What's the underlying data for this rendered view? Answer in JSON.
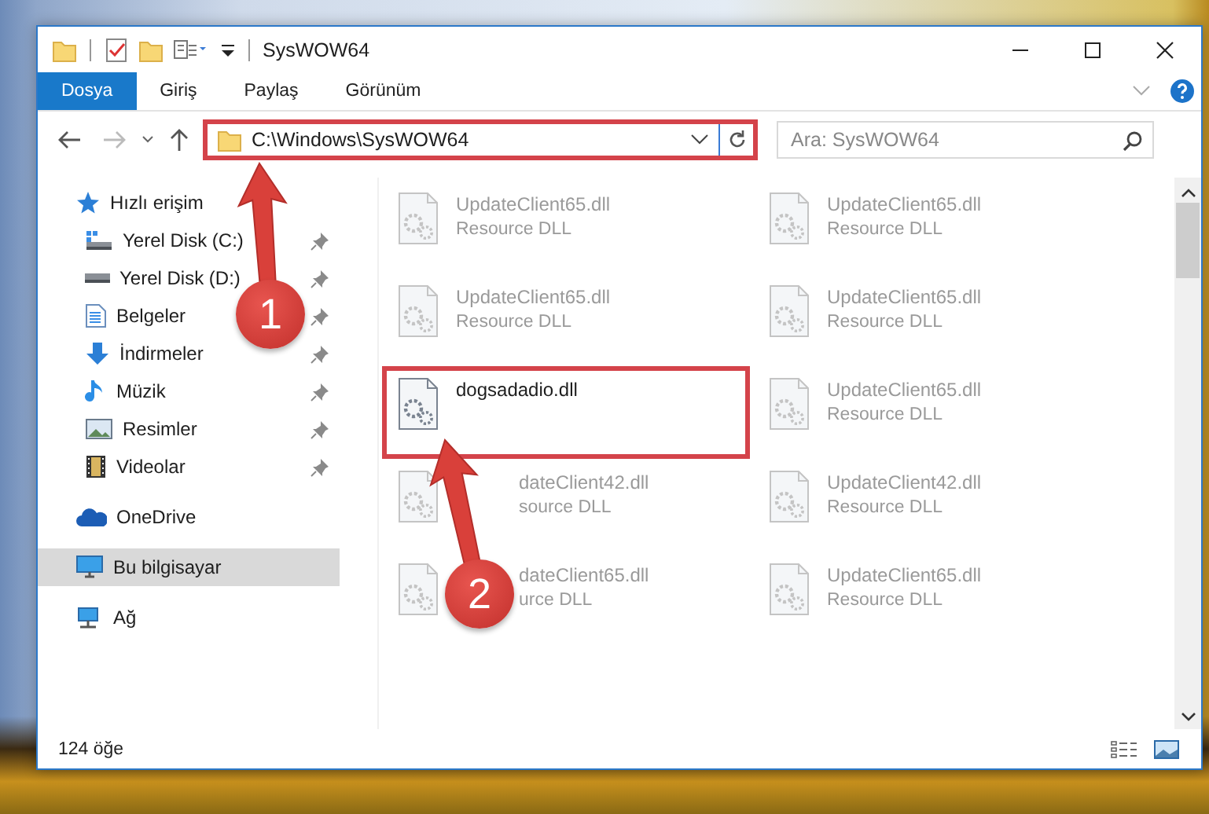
{
  "window": {
    "title": "SysWOW64"
  },
  "ribbon_tabs": [
    {
      "label": "Dosya",
      "selected": true
    },
    {
      "label": "Giriş",
      "selected": false
    },
    {
      "label": "Paylaş",
      "selected": false
    },
    {
      "label": "Görünüm",
      "selected": false
    }
  ],
  "address_bar": {
    "value": "C:\\Windows\\SysWOW64",
    "highlighted": true
  },
  "search": {
    "placeholder": "Ara: SysWOW64"
  },
  "navigation": [
    {
      "label": "Hızlı erişim",
      "kind": "quick",
      "selected": false,
      "children": [
        {
          "label": "Yerel Disk (C:)",
          "kind": "disk-c",
          "selected": false,
          "pinned": true
        },
        {
          "label": "Yerel Disk (D:)",
          "kind": "disk",
          "selected": false,
          "pinned": true
        },
        {
          "label": "Belgeler",
          "kind": "documents",
          "selected": false,
          "pinned": true
        },
        {
          "label": "İndirmeler",
          "kind": "downloads",
          "selected": false,
          "pinned": true
        },
        {
          "label": "Müzik",
          "kind": "music",
          "selected": false,
          "pinned": true
        },
        {
          "label": "Resimler",
          "kind": "pictures",
          "selected": false,
          "pinned": true
        },
        {
          "label": "Videolar",
          "kind": "videos",
          "selected": false,
          "pinned": true
        }
      ]
    },
    {
      "label": "OneDrive",
      "kind": "cloud",
      "selected": false
    },
    {
      "label": "Bu bilgisayar",
      "kind": "pc",
      "selected": true
    },
    {
      "label": "Ağ",
      "kind": "network",
      "selected": false
    }
  ],
  "files": [
    {
      "name": "UpdateClient65.dll",
      "type": "Resource DLL",
      "kind": "faded"
    },
    {
      "name": "UpdateClient65.dll",
      "type": "Resource DLL",
      "kind": "faded"
    },
    {
      "name": "UpdateClient65.dll",
      "type": "Resource DLL",
      "kind": "faded"
    },
    {
      "name": "UpdateClient65.dll",
      "type": "Resource DLL",
      "kind": "faded"
    },
    {
      "name": "dogsadadio.dll",
      "kind": "normal",
      "highlighted": true
    },
    {
      "name": "UpdateClient65.dll",
      "type": "Resource DLL",
      "kind": "faded"
    },
    {
      "name": "dateClient42.dll",
      "type": "source DLL",
      "kind": "covered"
    },
    {
      "name": "UpdateClient42.dll",
      "type": "Resource DLL",
      "kind": "faded"
    },
    {
      "name": "dateClient65.dll",
      "type": "urce DLL",
      "kind": "covered"
    },
    {
      "name": "UpdateClient65.dll",
      "type": "Resource DLL",
      "kind": "faded"
    }
  ],
  "callouts": [
    {
      "number": "1"
    },
    {
      "number": "2"
    }
  ],
  "status_bar": {
    "item_count": "124 öğe"
  }
}
